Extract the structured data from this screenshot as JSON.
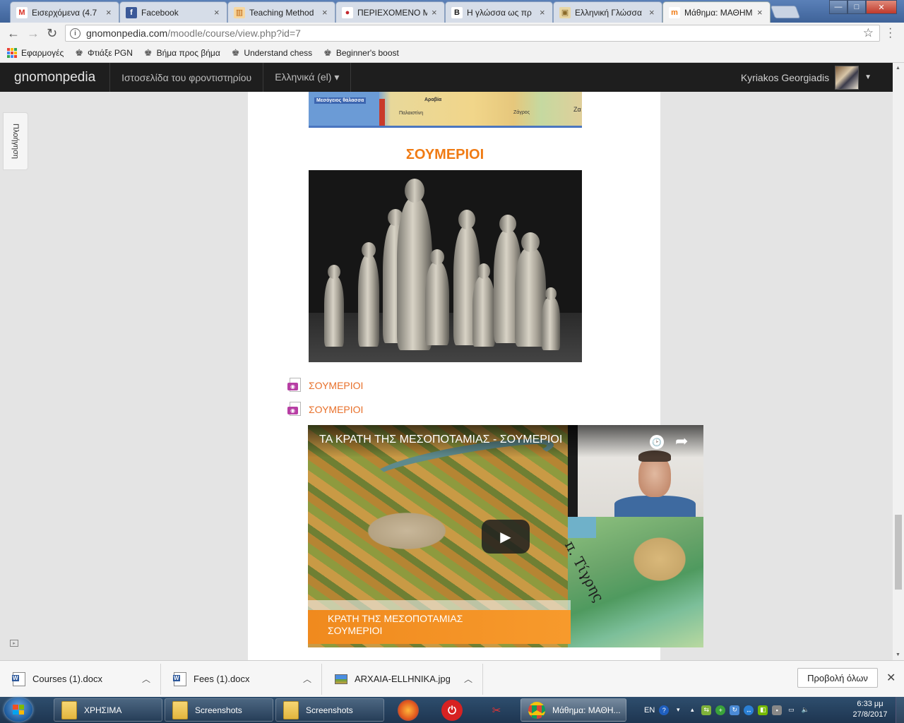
{
  "browser": {
    "tabs": [
      {
        "title": "Εισερχόμενα (4.7",
        "icon_text": "M",
        "icon_color": "#d93025",
        "icon_bg": "#ffffff"
      },
      {
        "title": "Facebook",
        "icon_text": "f",
        "icon_color": "#ffffff",
        "icon_bg": "#3b5998"
      },
      {
        "title": "Teaching Method",
        "icon_text": "▥",
        "icon_color": "#c0620c",
        "icon_bg": "#f6d7a0"
      },
      {
        "title": "ΠΕΡΙΕΧΟΜΕΝΟ Μ",
        "icon_text": "●",
        "icon_color": "#c3262d",
        "icon_bg": "#ffffff"
      },
      {
        "title": "Η γλώσσα ως πρ",
        "icon_text": "B",
        "icon_color": "#1a1a1a",
        "icon_bg": "#ffffff"
      },
      {
        "title": "Ελληνική Γλώσσα",
        "icon_text": "▣",
        "icon_color": "#8a6a2a",
        "icon_bg": "#e8d6a4"
      },
      {
        "title": "Μάθημα: ΜΑΘΗΜ",
        "icon_text": "m",
        "icon_color": "#f07b14",
        "icon_bg": "#ffffff"
      }
    ],
    "tab_close": "×",
    "window_controls": {
      "minimize": "—",
      "maximize": "□",
      "close": "✕"
    },
    "nav": {
      "back": "←",
      "forward": "→",
      "reload": "↻"
    },
    "url_host": "gnomonpedia.com",
    "url_path": "/moodle/course/view.php?id=7",
    "star": "☆",
    "bookmarks": [
      {
        "label": "Εφαρμογές",
        "icon": "apps-grid-icon"
      },
      {
        "label": "Φτιάξε PGN",
        "icon": "chess-icon"
      },
      {
        "label": "Βήμα προς βήμα",
        "icon": "chess-icon"
      },
      {
        "label": "Understand chess",
        "icon": "chess-icon"
      },
      {
        "label": "Beginner's boost",
        "icon": "chess-icon"
      }
    ]
  },
  "site": {
    "brand": "gnomonpedia",
    "nav_links": [
      "Ιστοσελίδα του φροντιστηρίου",
      "Ελληνικά (el) ▾"
    ],
    "user_name": "Kyriakos Georgiadis",
    "side_tab": "Πλοήγηση"
  },
  "content": {
    "map_labels": [
      "Μεσόγειος θάλασσα",
      "Αραβία",
      "Παλαιστίνη",
      "Ζάγρος",
      "Ζα"
    ],
    "section_title": "ΣΟΥΜΕΡΙΟΙ",
    "resource_links": [
      "ΣΟΥΜΕΡΙΟΙ",
      "ΣΟΥΜΕΡΙΟΙ"
    ],
    "video": {
      "title": "ΤΑ ΚΡΑΤΗ ΤΗΣ ΜΕΣΟΠΟΤΑΜΙΑΣ - ΣΟΥΜΕΡΙΟΙ",
      "caption_line1": "ΚΡΑΤΗ ΤΗΣ ΜΕΣΟΠΟΤΑΜΙΑΣ",
      "caption_line2": "ΣΟΥΜΕΡΙΟΙ",
      "map_label": "π. Τίγρης"
    }
  },
  "downloads": {
    "items": [
      {
        "name": "Courses (1).docx",
        "type": "doc"
      },
      {
        "name": "Fees (1).docx",
        "type": "doc"
      },
      {
        "name": "ARXAIA-ELLHNIKA.jpg",
        "type": "jpg"
      }
    ],
    "show_all": "Προβολή όλων",
    "close": "✕"
  },
  "taskbar": {
    "buttons": [
      {
        "label": "ΧΡΗΣΙΜΑ"
      },
      {
        "label": "Screenshots"
      },
      {
        "label": "Screenshots"
      }
    ],
    "chrome_label": "Μάθημα: ΜΑΘΗ...",
    "language": "EN",
    "time": "6:33 μμ",
    "date": "27/8/2017"
  }
}
